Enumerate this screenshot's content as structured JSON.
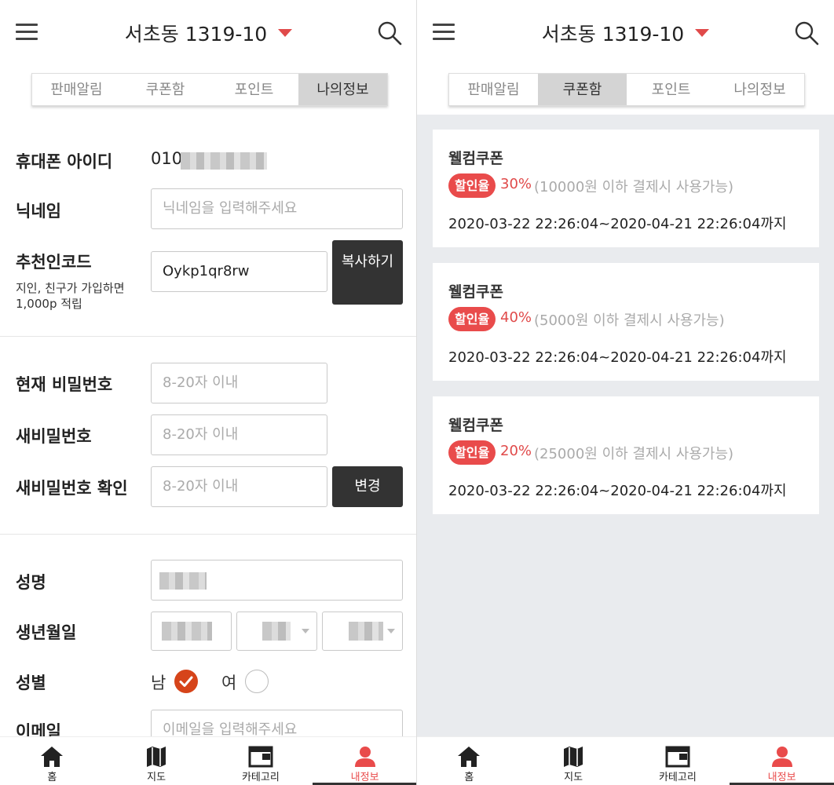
{
  "header": {
    "location": "서초동 1319-10"
  },
  "tabs": [
    "판매알림",
    "쿠폰함",
    "포인트",
    "나의정보"
  ],
  "profile": {
    "phone_label": "휴대폰 아이디",
    "phone_value": "010",
    "nickname_label": "닉네임",
    "nickname_placeholder": "닉네임을 입력해주세요",
    "referral_label": "추천인코드",
    "referral_sub": "지인, 친구가 가입하면 1,000p 적립",
    "referral_code": "Oykp1qr8rw",
    "copy_button": "복사하기",
    "current_pw_label": "현재 비밀번호",
    "new_pw_label": "새비밀번호",
    "confirm_pw_label": "새비밀번호 확인",
    "pw_placeholder": "8-20자 이내",
    "change_button": "변경",
    "name_label": "성명",
    "birth_label": "생년월일",
    "gender_label": "성별",
    "gender_male": "남",
    "gender_female": "여",
    "gender_selected": "남",
    "email_label": "이메일",
    "email_placeholder": "이메일을 입력해주세요"
  },
  "coupons": [
    {
      "title": "웰컴쿠폰",
      "badge": "할인율",
      "percent": "30%",
      "condition": "(10000원 이하 결제시 사용가능)",
      "period": "2020-03-22 22:26:04~2020-04-21 22:26:04까지"
    },
    {
      "title": "웰컴쿠폰",
      "badge": "할인율",
      "percent": "40%",
      "condition": "(5000원 이하 결제시 사용가능)",
      "period": "2020-03-22 22:26:04~2020-04-21 22:26:04까지"
    },
    {
      "title": "웰컴쿠폰",
      "badge": "할인율",
      "percent": "20%",
      "condition": "(25000원 이하 결제시 사용가능)",
      "period": "2020-03-22 22:26:04~2020-04-21 22:26:04까지"
    }
  ],
  "bottom_nav": [
    "홈",
    "지도",
    "카테고리",
    "내정보"
  ],
  "colors": {
    "accent": "#e94b4b",
    "radio_checked": "#d6441a",
    "dark_button": "#333333",
    "coupon_bg": "#e9ebee"
  }
}
